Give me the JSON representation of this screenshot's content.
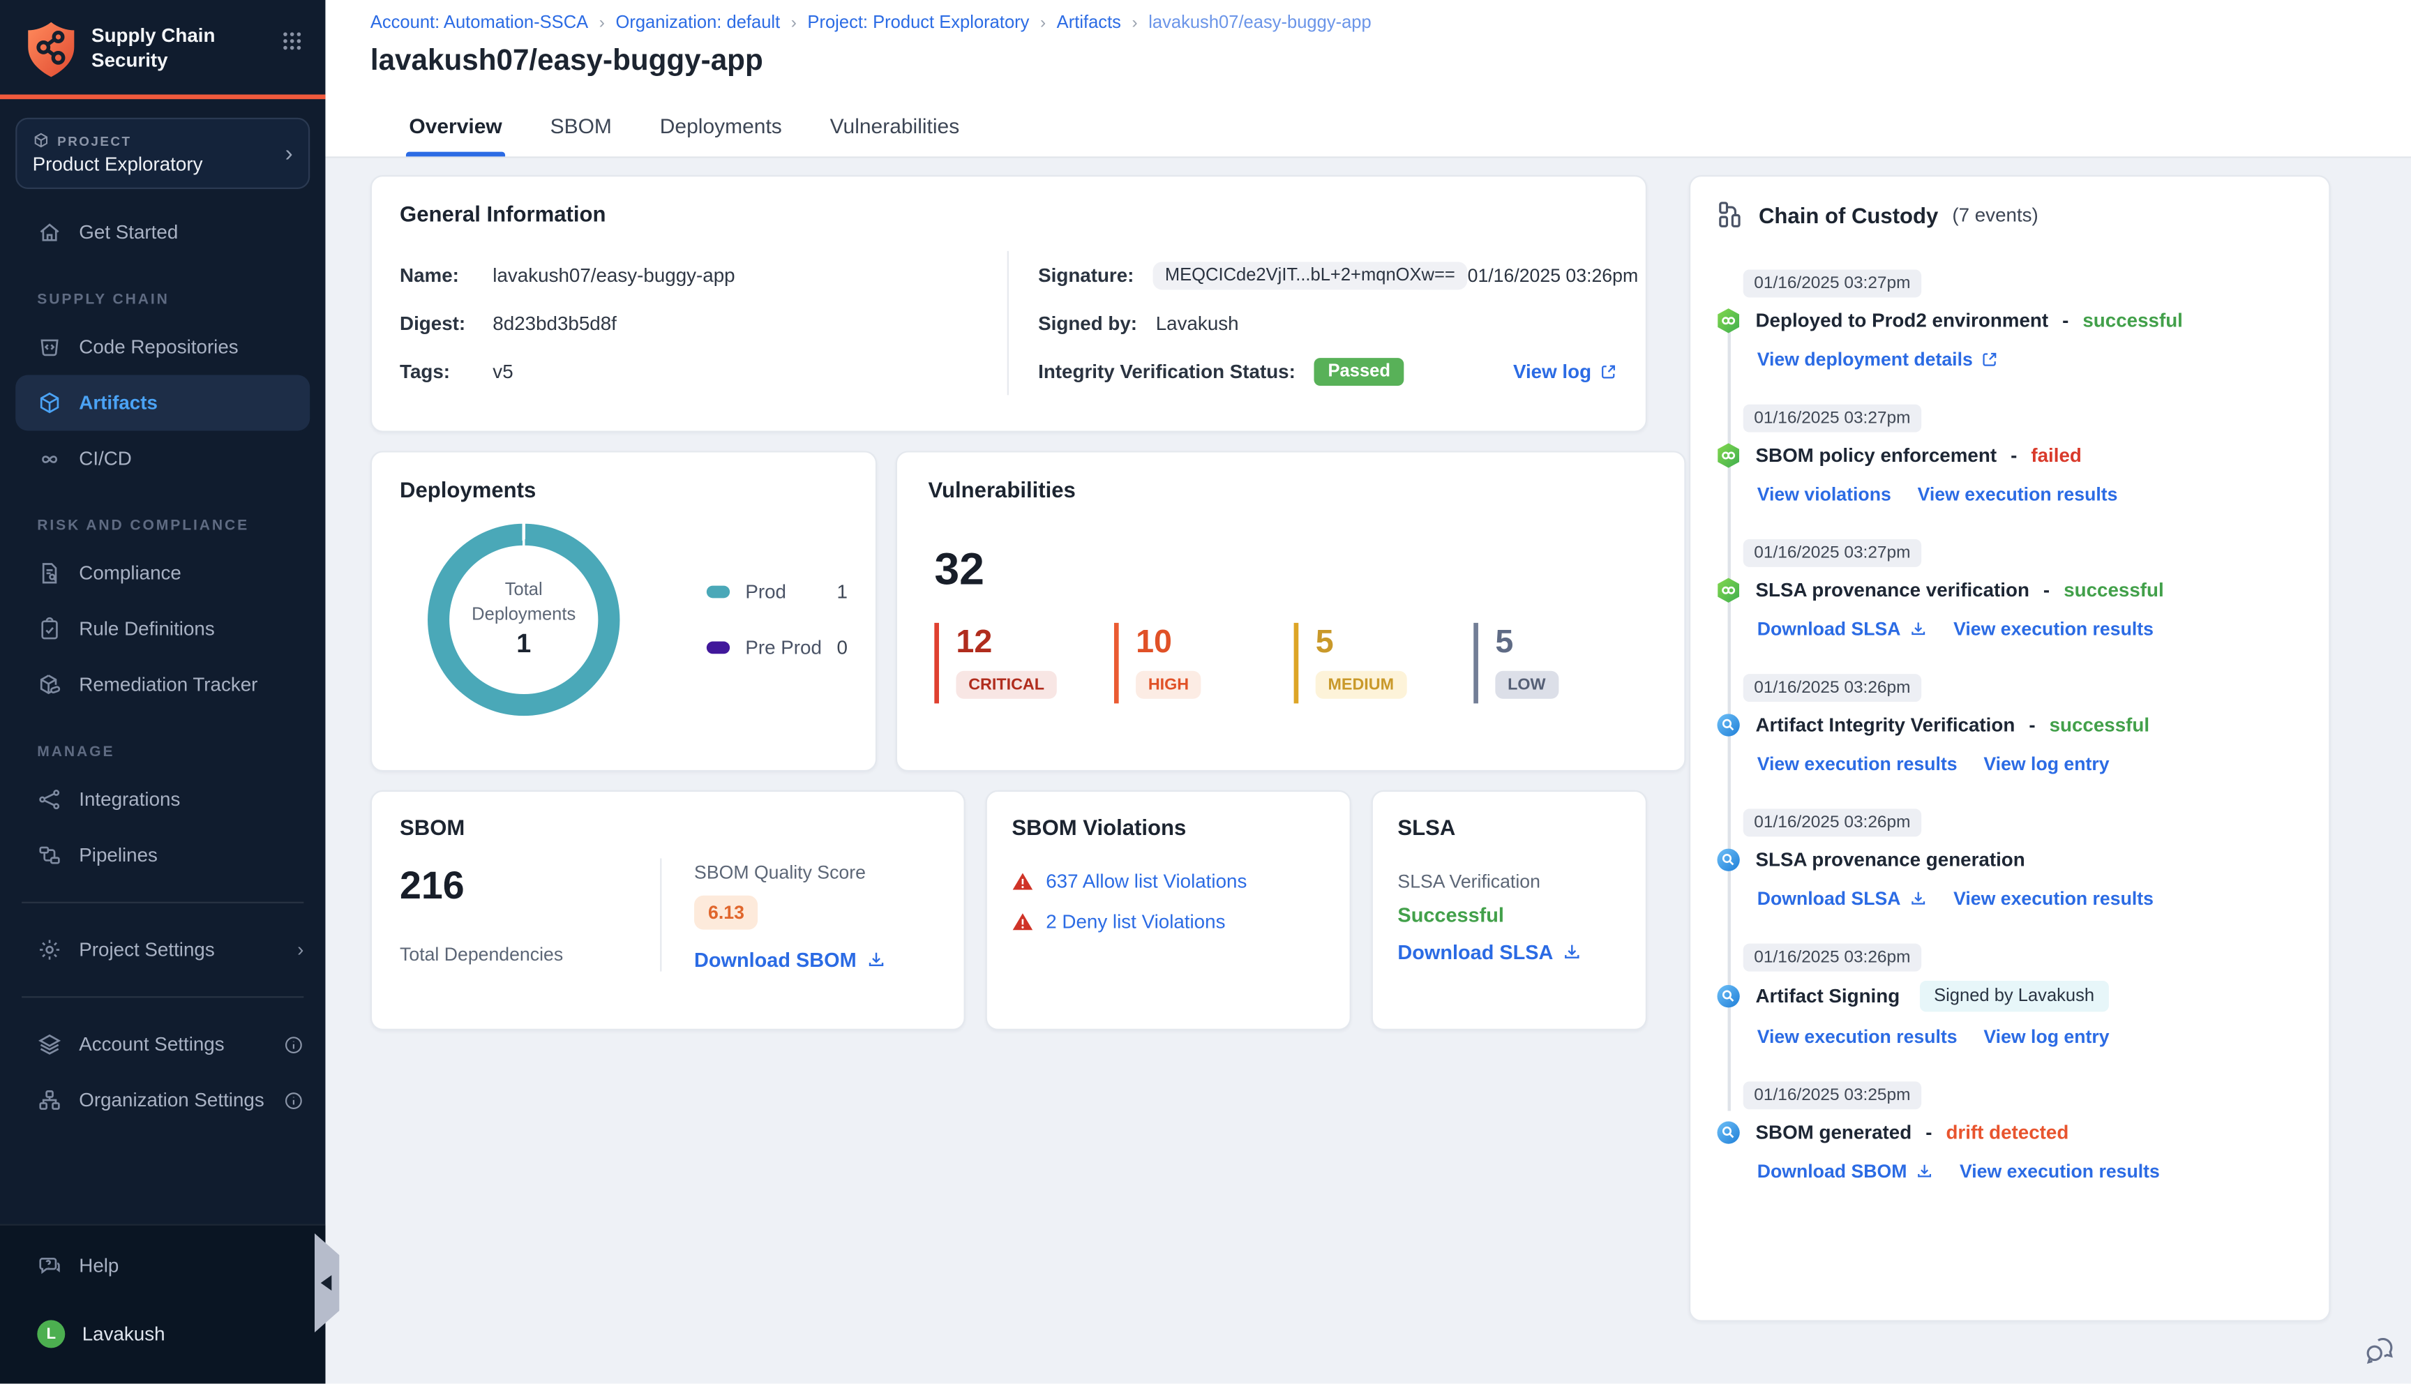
{
  "app": {
    "title": "Supply Chain Security"
  },
  "colors": {
    "accent_orange": "#f05a3d",
    "sidebar_bg": "#101c2e",
    "active_nav_blue": "#4ba3f5",
    "link_blue": "#2b6be4",
    "passed_green": "#58b158",
    "success_green": "#42a04a",
    "fail_red": "#d93a2b",
    "drift_orange": "#e8542e",
    "donut_teal": "#4aa8b8",
    "preprod_purple": "#41189b",
    "critical": "#b02c1d",
    "high": "#e05127",
    "medium": "#c9992a",
    "low": "#5f6b85",
    "score_orange": "#e0662c"
  },
  "icons": {
    "logo": "shield-network",
    "grid_menu": "3x3-dots",
    "project": "cube",
    "chevron": "›",
    "get_started": "home",
    "code_repositories": "repo-bucket",
    "artifacts": "box",
    "cicd": "infinity",
    "compliance": "file-search",
    "rule_definitions": "clipboard-check",
    "remediation_tracker": "box-pill",
    "integrations": "share-nodes",
    "pipelines": "flow",
    "project_settings": "gear",
    "account_settings": "layers",
    "organization_settings": "sitemap",
    "help": "chat-bubble",
    "info": "info-circle",
    "external_link": "arrow-out-box",
    "download": "arrow-down-tray",
    "warning": "red-triangle",
    "chain_of_custody": "flow-chart",
    "pipeline_event": "green-hexagon-link",
    "scan_event": "blue-circle-magnifier",
    "chat_launcher": "double-chat-bubbles",
    "collapse": "◀"
  },
  "sidebar": {
    "project": {
      "label": "PROJECT",
      "name": "Product Exploratory"
    },
    "get_started": "Get Started",
    "sections": [
      {
        "label": "SUPPLY CHAIN",
        "items": [
          {
            "label": "Code Repositories"
          },
          {
            "label": "Artifacts",
            "active": true
          },
          {
            "label": "CI/CD"
          }
        ]
      },
      {
        "label": "RISK AND COMPLIANCE",
        "items": [
          {
            "label": "Compliance"
          },
          {
            "label": "Rule Definitions"
          },
          {
            "label": "Remediation Tracker"
          }
        ]
      },
      {
        "label": "MANAGE",
        "items": [
          {
            "label": "Integrations"
          },
          {
            "label": "Pipelines"
          }
        ]
      }
    ],
    "project_settings": "Project Settings",
    "account_settings": "Account Settings",
    "organization_settings": "Organization Settings",
    "help_label": "Help",
    "user": {
      "name": "Lavakush",
      "initial": "L"
    }
  },
  "breadcrumb": {
    "separator": "›",
    "items": [
      "Account: Automation-SSCA",
      "Organization: default",
      "Project: Product Exploratory",
      "Artifacts",
      "lavakush07/easy-buggy-app"
    ]
  },
  "page": {
    "title": "lavakush07/easy-buggy-app"
  },
  "tabs": [
    {
      "label": "Overview",
      "active": true
    },
    {
      "label": "SBOM"
    },
    {
      "label": "Deployments"
    },
    {
      "label": "Vulnerabilities"
    }
  ],
  "general_info": {
    "title": "General Information",
    "name_label": "Name:",
    "name": "lavakush07/easy-buggy-app",
    "digest_label": "Digest:",
    "digest": "8d23bd3b5d8f",
    "tags_label": "Tags:",
    "tags": "v5",
    "signature_label": "Signature:",
    "signature": "MEQCICde2VjIT...bL+2+mqnOXw==",
    "signed_at": "01/16/2025 03:26pm",
    "signed_by_label": "Signed by:",
    "signed_by": "Lavakush",
    "integrity_label": "Integrity Verification Status:",
    "integrity_status": "Passed",
    "view_log": "View log"
  },
  "deployments": {
    "title": "Deployments",
    "center_label_line1": "Total",
    "center_label_line2": "Deployments",
    "total": "1",
    "legend": [
      {
        "label": "Prod",
        "value": "1",
        "color": "#4aa8b8"
      },
      {
        "label": "Pre Prod",
        "value": "0",
        "color": "#41189b"
      }
    ]
  },
  "vulnerabilities": {
    "title": "Vulnerabilities",
    "total": "32",
    "severities": [
      {
        "count": "12",
        "label": "CRITICAL",
        "color": "#b02c1d"
      },
      {
        "count": "10",
        "label": "HIGH",
        "color": "#e05127"
      },
      {
        "count": "5",
        "label": "MEDIUM",
        "color": "#c9992a"
      },
      {
        "count": "5",
        "label": "LOW",
        "color": "#5f6b85"
      }
    ]
  },
  "sbom": {
    "title": "SBOM",
    "total": "216",
    "total_label": "Total Dependencies",
    "quality_label": "SBOM Quality Score",
    "quality_score": "6.13",
    "download": "Download SBOM"
  },
  "sbom_violations": {
    "title": "SBOM Violations",
    "items": [
      {
        "label": "637 Allow list Violations"
      },
      {
        "label": "2 Deny list Violations"
      }
    ]
  },
  "slsa": {
    "title": "SLSA",
    "verification_label": "SLSA Verification",
    "status": "Successful",
    "download": "Download SLSA"
  },
  "chain_of_custody": {
    "title": "Chain of Custody",
    "count": "(7 events)",
    "dash": "-",
    "events": [
      {
        "time": "01/16/2025 03:27pm",
        "title": "Deployed to Prod2 environment",
        "status": "successful",
        "status_type": "success",
        "icon": "pipeline-event",
        "links": [
          {
            "label": "View deployment details",
            "icon": "external"
          }
        ]
      },
      {
        "time": "01/16/2025 03:27pm",
        "title": "SBOM policy enforcement",
        "status": "failed",
        "status_type": "fail",
        "icon": "pipeline-event",
        "links": [
          {
            "label": "View violations"
          },
          {
            "label": "View execution results"
          }
        ]
      },
      {
        "time": "01/16/2025 03:27pm",
        "title": "SLSA provenance verification",
        "status": "successful",
        "status_type": "success",
        "icon": "pipeline-event",
        "links": [
          {
            "label": "Download SLSA",
            "icon": "download"
          },
          {
            "label": "View execution results"
          }
        ]
      },
      {
        "time": "01/16/2025 03:26pm",
        "title": "Artifact Integrity Verification",
        "status": "successful",
        "status_type": "success",
        "icon": "scan-event",
        "links": [
          {
            "label": "View execution results"
          },
          {
            "label": "View log entry"
          }
        ]
      },
      {
        "time": "01/16/2025 03:26pm",
        "title": "SLSA provenance generation",
        "icon": "scan-event",
        "links": [
          {
            "label": "Download SLSA",
            "icon": "download"
          },
          {
            "label": "View execution results"
          }
        ]
      },
      {
        "time": "01/16/2025 03:26pm",
        "title": "Artifact Signing",
        "badge": "Signed by Lavakush",
        "icon": "scan-event",
        "links": [
          {
            "label": "View execution results"
          },
          {
            "label": "View log entry"
          }
        ]
      },
      {
        "time": "01/16/2025 03:25pm",
        "title": "SBOM generated",
        "status": "drift detected",
        "status_type": "warn",
        "icon": "scan-event",
        "links": [
          {
            "label": "Download SBOM",
            "icon": "download"
          },
          {
            "label": "View execution results"
          }
        ]
      }
    ]
  },
  "chart_data": {
    "type": "pie",
    "title": "Deployments",
    "categories": [
      "Prod",
      "Pre Prod"
    ],
    "values": [
      1,
      0
    ],
    "center_label": "Total Deployments",
    "total": 1,
    "colors": [
      "#4aa8b8",
      "#41189b"
    ],
    "legend_position": "right"
  }
}
